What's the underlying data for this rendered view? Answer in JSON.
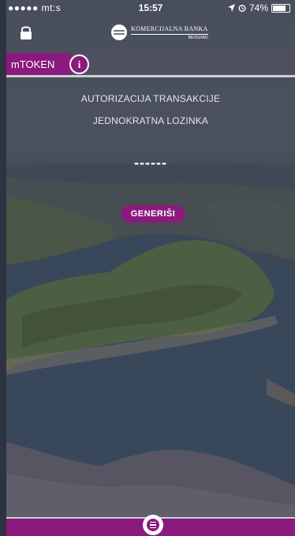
{
  "status_bar": {
    "carrier": "●●●●● mt:s",
    "time": "15:57",
    "battery": "74%"
  },
  "header": {
    "brand": "KOMERCIJALNA BANKA",
    "brand_sub": "BEOGRAD"
  },
  "tab": {
    "label": "mTOKEN",
    "info_glyph": "i"
  },
  "content": {
    "title": "AUTORIZACIJA TRANSAKCIJE",
    "subtitle": "JEDNOKRATNA LOZINKA",
    "otp_value": "------",
    "generate_label": "GENERIŠI"
  },
  "icons": {
    "lock": "lock-icon",
    "info": "info-icon",
    "menu": "menu-icon",
    "wifi": "wifi-icon",
    "location": "location-arrow-icon",
    "alarm": "alarm-icon",
    "battery": "battery-icon"
  },
  "colors": {
    "accent": "#8a1a7e",
    "bar": "#50505f"
  }
}
